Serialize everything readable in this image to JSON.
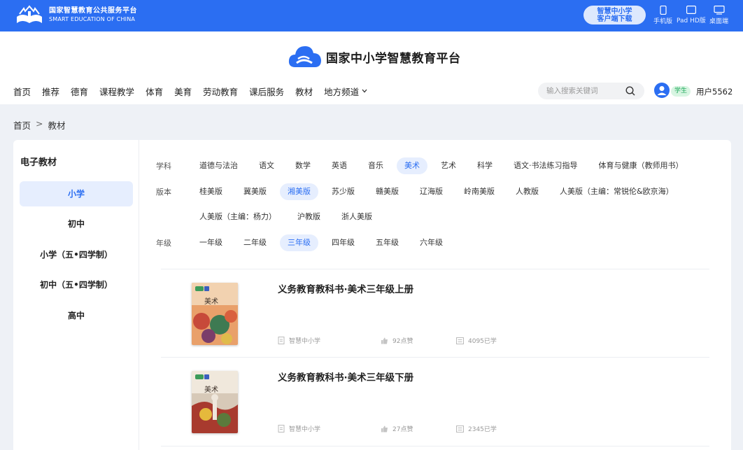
{
  "topbar": {
    "logo_cn": "国家智慧教育公共服务平台",
    "logo_en": "SMART EDUCATION OF CHINA",
    "download_line1": "智慧中小学",
    "download_line2": "客户端下载",
    "devices": [
      {
        "label": "手机版",
        "icon": "phone-icon"
      },
      {
        "label": "Pad HD版",
        "icon": "tablet-icon"
      },
      {
        "label": "桌面端",
        "icon": "desktop-icon"
      }
    ]
  },
  "header": {
    "brand_title": "国家中小学智慧教育平台",
    "nav": [
      "首页",
      "推荐",
      "德育",
      "课程教学",
      "体育",
      "美育",
      "劳动教育",
      "课后服务",
      "教材",
      "地方频道"
    ],
    "search_placeholder": "输入搜索关键词",
    "role_badge": "学生",
    "username": "用户5562"
  },
  "breadcrumb": {
    "home": "首页",
    "sep": ">",
    "current": "教材"
  },
  "sidebar": {
    "title": "电子教材",
    "items": [
      "小学",
      "初中",
      "小学（五•四学制）",
      "初中（五•四学制）",
      "高中"
    ],
    "active_index": 0
  },
  "filters": {
    "subject": {
      "label": "学科",
      "options": [
        "道德与法治",
        "语文",
        "数学",
        "英语",
        "音乐",
        "美术",
        "艺术",
        "科学",
        "语文·书法练习指导",
        "体育与健康（教师用书）"
      ],
      "selected": "美术"
    },
    "version": {
      "label": "版本",
      "options_row1": [
        "桂美版",
        "冀美版",
        "湘美版",
        "苏少版",
        "赣美版",
        "辽海版",
        "岭南美版",
        "人教版",
        "人美版（主编：常锐伦&欧京海）"
      ],
      "options_row2": [
        "人美版（主编：杨力）",
        "沪教版",
        "浙人美版"
      ],
      "selected": "湘美版"
    },
    "grade": {
      "label": "年级",
      "options": [
        "一年级",
        "二年级",
        "三年级",
        "四年级",
        "五年级",
        "六年级"
      ],
      "selected": "三年级"
    }
  },
  "books": [
    {
      "title": "义务教育教科书·美术三年级上册",
      "source": "智慧中小学",
      "likes": "92点赞",
      "learners": "4095已学",
      "cover_text": "美术"
    },
    {
      "title": "义务教育教科书·美术三年级下册",
      "source": "智慧中小学",
      "likes": "27点赞",
      "learners": "2345已学",
      "cover_text": "美术"
    }
  ],
  "colors": {
    "primary": "#2b6ef2",
    "chip_bg": "#e6eefe",
    "badge_green": "#1ea85a"
  }
}
